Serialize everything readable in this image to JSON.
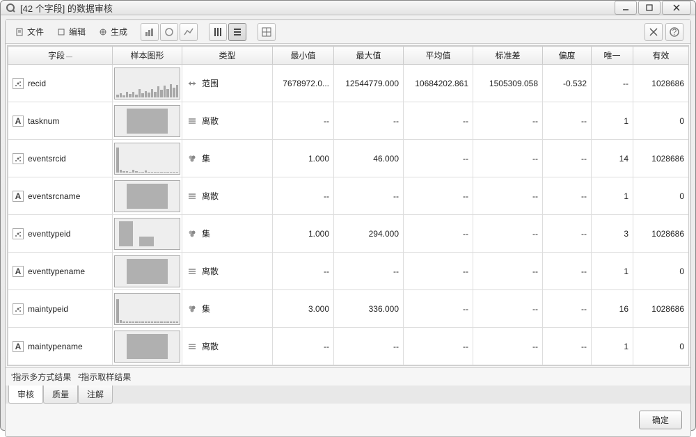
{
  "window": {
    "title": "[42 个字段] 的数据审核"
  },
  "toolbar": {
    "file": "文件",
    "edit": "编辑",
    "generate": "生成"
  },
  "columns": {
    "field": "字段",
    "sample": "样本图形",
    "type": "类型",
    "min": "最小值",
    "max": "最大值",
    "mean": "平均值",
    "stddev": "标准差",
    "skew": "偏度",
    "unique": "唯一",
    "valid": "有效"
  },
  "types": {
    "range": "范围",
    "discrete": "离散",
    "set": "集"
  },
  "rows": [
    {
      "name": "recid",
      "fieldKind": "cont",
      "chart": "hist",
      "type": "range",
      "min": "7678972.0...",
      "max": "12544779.000",
      "mean": "10684202.861",
      "stddev": "1505309.058",
      "skew": "-0.532",
      "unique": "--",
      "valid": "1028686"
    },
    {
      "name": "tasknum",
      "fieldKind": "text",
      "chart": "bigbar",
      "type": "discrete",
      "min": "--",
      "max": "--",
      "mean": "--",
      "stddev": "--",
      "skew": "--",
      "unique": "1",
      "valid": "0"
    },
    {
      "name": "eventsrcid",
      "fieldKind": "cont",
      "chart": "spike",
      "type": "set",
      "min": "1.000",
      "max": "46.000",
      "mean": "--",
      "stddev": "--",
      "skew": "--",
      "unique": "14",
      "valid": "1028686"
    },
    {
      "name": "eventsrcname",
      "fieldKind": "text",
      "chart": "bigbar",
      "type": "discrete",
      "min": "--",
      "max": "--",
      "mean": "--",
      "stddev": "--",
      "skew": "--",
      "unique": "1",
      "valid": "0"
    },
    {
      "name": "eventtypeid",
      "fieldKind": "cont",
      "chart": "twobar",
      "type": "set",
      "min": "1.000",
      "max": "294.000",
      "mean": "--",
      "stddev": "--",
      "skew": "--",
      "unique": "3",
      "valid": "1028686"
    },
    {
      "name": "eventtypename",
      "fieldKind": "text",
      "chart": "bigbar",
      "type": "discrete",
      "min": "--",
      "max": "--",
      "mean": "--",
      "stddev": "--",
      "skew": "--",
      "unique": "1",
      "valid": "0"
    },
    {
      "name": "maintypeid",
      "fieldKind": "cont",
      "chart": "spike2",
      "type": "set",
      "min": "3.000",
      "max": "336.000",
      "mean": "--",
      "stddev": "--",
      "skew": "--",
      "unique": "16",
      "valid": "1028686"
    },
    {
      "name": "maintypename",
      "fieldKind": "text",
      "chart": "bigbar",
      "type": "discrete",
      "min": "--",
      "max": "--",
      "mean": "--",
      "stddev": "--",
      "skew": "--",
      "unique": "1",
      "valid": "0"
    }
  ],
  "footer": {
    "note1": "'指示多方式结果",
    "note2": "²指示取样结果"
  },
  "tabs": {
    "audit": "审核",
    "quality": "质量",
    "annotations": "注解"
  },
  "buttons": {
    "ok": "确定"
  }
}
